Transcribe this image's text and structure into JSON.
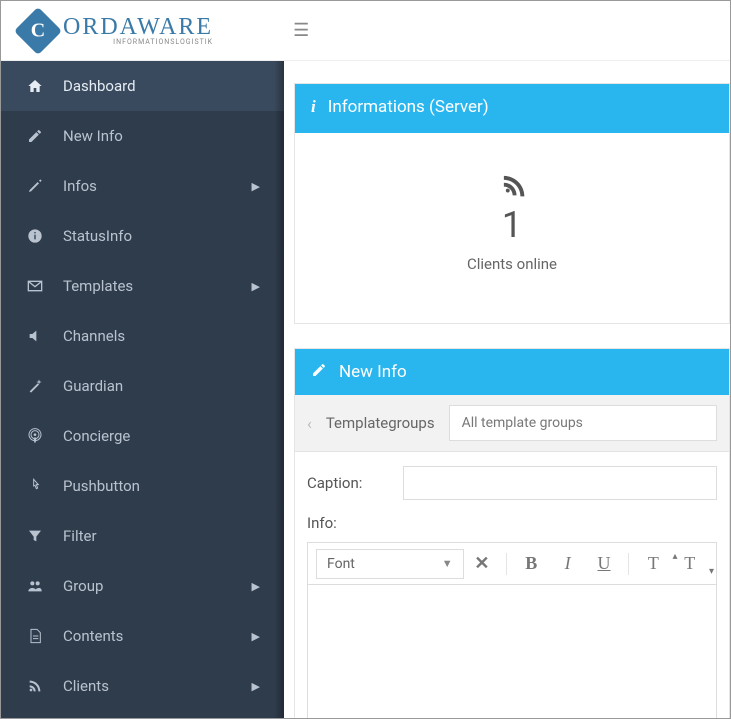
{
  "logo": {
    "main": "ORDAWARE",
    "sub": "INFORMATIONSLOGISTIK"
  },
  "sidebar": {
    "items": [
      {
        "label": "Dashboard",
        "icon": "home",
        "active": true,
        "expandable": false
      },
      {
        "label": "New Info",
        "icon": "edit",
        "active": false,
        "expandable": false
      },
      {
        "label": "Infos",
        "icon": "pencil",
        "active": false,
        "expandable": true
      },
      {
        "label": "StatusInfo",
        "icon": "info",
        "active": false,
        "expandable": false
      },
      {
        "label": "Templates",
        "icon": "envelope",
        "active": false,
        "expandable": true
      },
      {
        "label": "Channels",
        "icon": "volume",
        "active": false,
        "expandable": false
      },
      {
        "label": "Guardian",
        "icon": "wand",
        "active": false,
        "expandable": false
      },
      {
        "label": "Concierge",
        "icon": "podcast",
        "active": false,
        "expandable": false
      },
      {
        "label": "Pushbutton",
        "icon": "pointer",
        "active": false,
        "expandable": false
      },
      {
        "label": "Filter",
        "icon": "filter",
        "active": false,
        "expandable": false
      },
      {
        "label": "Group",
        "icon": "group",
        "active": false,
        "expandable": true
      },
      {
        "label": "Contents",
        "icon": "file",
        "active": false,
        "expandable": true
      },
      {
        "label": "Clients",
        "icon": "rss",
        "active": false,
        "expandable": true
      }
    ]
  },
  "panels": {
    "informations": {
      "title": "Informations (Server)",
      "clients_count": "1",
      "clients_label": "Clients online"
    },
    "newinfo": {
      "title": "New Info",
      "templategroups_label": "Templategroups",
      "templategroups_value": "All template groups",
      "caption_label": "Caption:",
      "caption_value": "",
      "info_label": "Info:",
      "font_label": "Font"
    }
  }
}
